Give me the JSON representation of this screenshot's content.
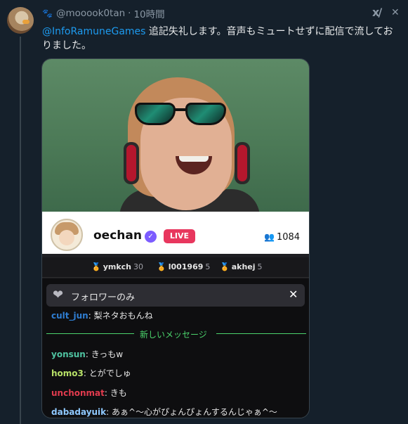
{
  "tweet": {
    "handle": "@mooook0tan",
    "separator": "·",
    "time": "10時間",
    "mention": "@InfoRamuneGames",
    "text": " 追記失礼します。音声もミュートせずに配信で流しておりました。",
    "icons": [
      "paw-icon",
      "x-logo-icon",
      "close-icon"
    ]
  },
  "stream": {
    "streamer_name": "oechan",
    "live_label": "LIVE",
    "viewer_count": "1084",
    "gifters": [
      {
        "name": "ymkch",
        "count": "30"
      },
      {
        "name": "l001969",
        "count": "5"
      },
      {
        "name": "akhej",
        "count": "5"
      }
    ]
  },
  "chat": {
    "filter_label": "フォロワーのみ",
    "new_messages_label": "新しいメッセージ",
    "messages": [
      {
        "user": "cult_jun",
        "text": "梨ネタおもんね",
        "color": "#2f7dd1"
      },
      {
        "user": "yonsun",
        "text": "きっもw",
        "color": "#4fc3a1"
      },
      {
        "user": "homo3",
        "text": "とがでしゅ",
        "color": "#b7e067"
      },
      {
        "user": "unchonmat",
        "text": "きも",
        "color": "#e23b4e"
      },
      {
        "user": "dabadayuik",
        "text": "あぁ^〜心がぴょんぴょんするんじゃぁ^〜",
        "color": "#8fc9ff"
      }
    ]
  },
  "colors": {
    "background": "#15202b",
    "link": "#1d9bf0",
    "live": "#e8375e",
    "new_message": "#4bd36c",
    "verified": "#7c5cff"
  }
}
